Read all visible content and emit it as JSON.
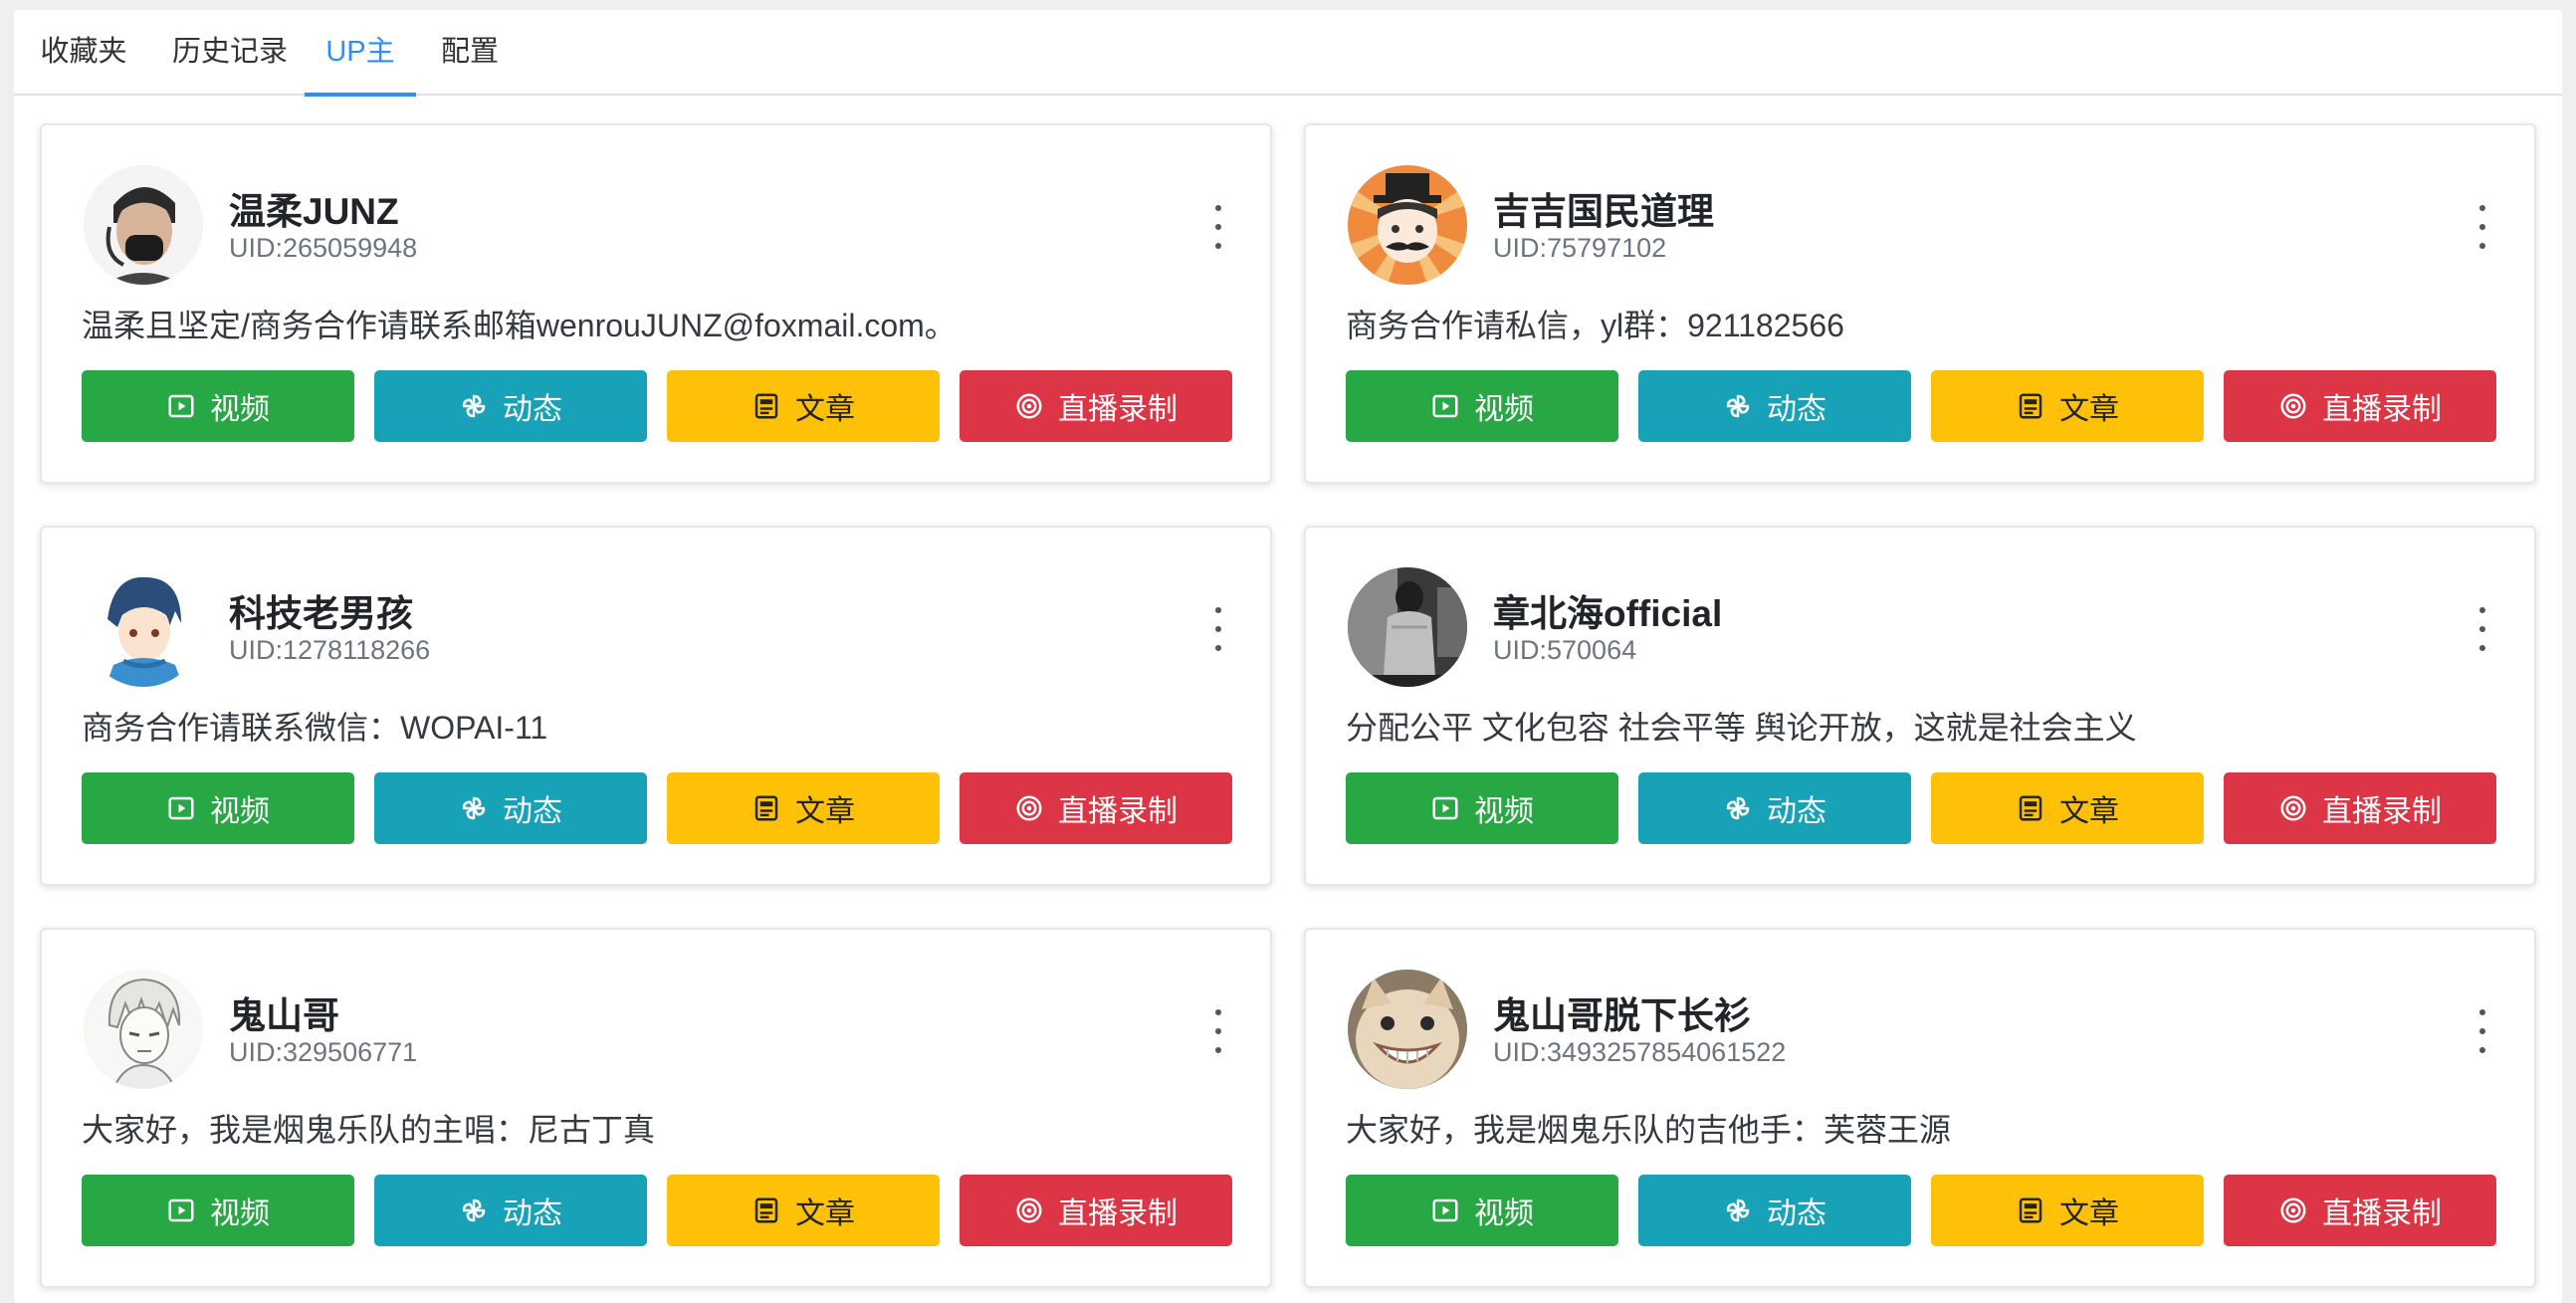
{
  "tabs": [
    {
      "label": "收藏夹",
      "active": false
    },
    {
      "label": "历史记录",
      "active": false
    },
    {
      "label": "UP主",
      "active": true
    },
    {
      "label": "配置",
      "active": false
    }
  ],
  "colors": {
    "accent": "#2c8ef8",
    "video": "#28a745",
    "dynamic": "#17a2b8",
    "article": "#ffc107",
    "live": "#dc3545"
  },
  "actions": {
    "video": "视频",
    "dynamic": "动态",
    "article": "文章",
    "live": "直播录制"
  },
  "icons": {
    "video": "play-box-icon",
    "dynamic": "pinwheel-icon",
    "article": "article-icon",
    "live": "record-target-icon",
    "more": "more-vertical-icon"
  },
  "uploaders": [
    {
      "name": "温柔JUNZ",
      "uid": "UID:265059948",
      "desc": "温柔且坚定/商务合作请联系邮箱wenrouJUNZ@foxmail.com。"
    },
    {
      "name": "吉吉国民道理",
      "uid": "UID:75797102",
      "desc": "商务合作请私信，yl群：921182566"
    },
    {
      "name": "科技老男孩",
      "uid": "UID:1278118266",
      "desc": "商务合作请联系微信：WOPAI-11"
    },
    {
      "name": "章北海official",
      "uid": "UID:570064",
      "desc": "分配公平 文化包容 社会平等 舆论开放，这就是社会主义"
    },
    {
      "name": "鬼山哥",
      "uid": "UID:329506771",
      "desc": "大家好，我是烟鬼乐队的主唱：尼古丁真"
    },
    {
      "name": "鬼山哥脱下长衫",
      "uid": "UID:3493257854061522",
      "desc": "大家好，我是烟鬼乐队的吉他手：芙蓉王源"
    }
  ]
}
